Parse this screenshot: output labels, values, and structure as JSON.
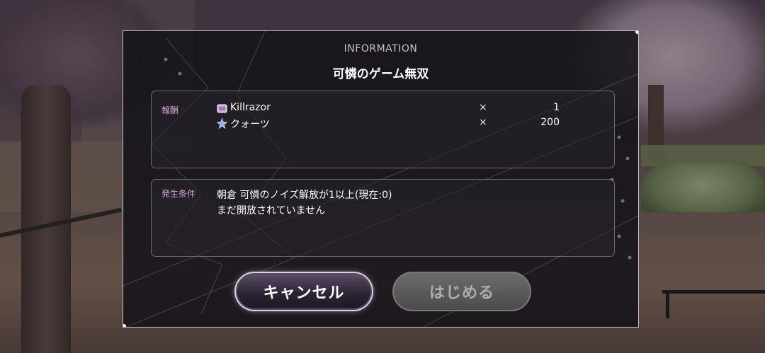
{
  "dialog": {
    "header": "INFORMATION",
    "title": "可憐のゲーム無双"
  },
  "reward": {
    "label": "報酬",
    "items": [
      {
        "icon": "ticket-icon",
        "name": "Killrazor",
        "times": "×",
        "count": "1"
      },
      {
        "icon": "quartz-star-icon",
        "name": "クォーツ",
        "times": "×",
        "count": "200"
      }
    ]
  },
  "condition": {
    "label": "発生条件",
    "line1": "朝倉 可憐のノイズ解放が1以上(現在:0)",
    "line2": "まだ開放されていません"
  },
  "buttons": {
    "cancel": "キャンセル",
    "start": "はじめる"
  },
  "colors": {
    "label_accent": "#d8a9d8",
    "dialog_border": "#e6e1eb"
  }
}
